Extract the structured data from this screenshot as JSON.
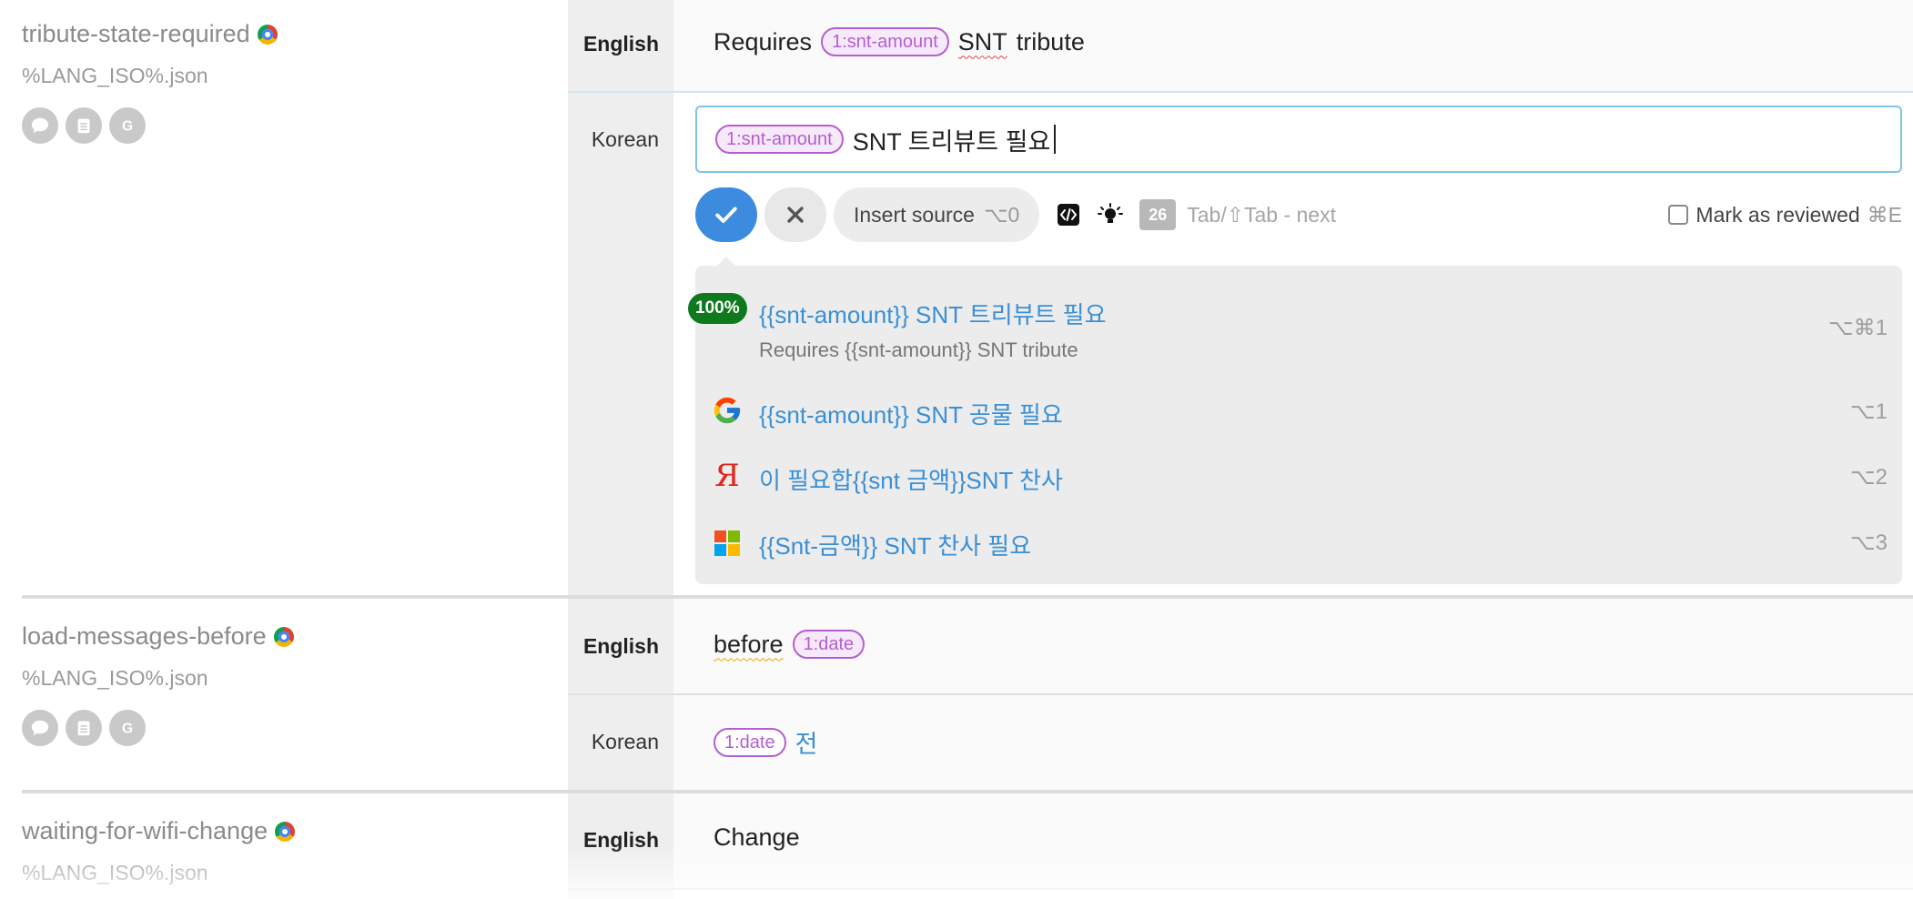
{
  "entries": [
    {
      "key": "tribute-state-required",
      "file": "%LANG_ISO%.json",
      "source_lang": "English",
      "source_text_before": "Requires",
      "source_placeholder": "1:snt-amount",
      "source_word_flagged": "SNT",
      "source_text_after": "tribute",
      "target_lang": "Korean",
      "target_placeholder": "1:snt-amount",
      "target_text": "SNT 트리뷰트 필요"
    },
    {
      "key": "load-messages-before",
      "file": "%LANG_ISO%.json",
      "source_lang": "English",
      "source_word_flagged": "before",
      "source_placeholder": "1:date",
      "target_lang": "Korean",
      "target_placeholder": "1:date",
      "target_text": "전"
    },
    {
      "key": "waiting-for-wifi-change",
      "file": "%LANG_ISO%.json",
      "source_lang": "English",
      "source_text": "Change"
    }
  ],
  "toolbar": {
    "insert_label": "Insert source",
    "insert_shortcut": "⌥0",
    "counter": "26",
    "hint": "Tab/⇧Tab - next",
    "reviewed_label": "Mark as reviewed",
    "reviewed_shortcut": "⌘E"
  },
  "suggestions": [
    {
      "provider": "translation-memory",
      "match": "100%",
      "text": "{{snt-amount}} SNT 트리뷰트 필요",
      "source": "Requires {{snt-amount}} SNT tribute",
      "shortcut": "⌥⌘1"
    },
    {
      "provider": "google",
      "text": "{{snt-amount}} SNT 공물 필요",
      "shortcut": "⌥1"
    },
    {
      "provider": "yandex",
      "icon_glyph": "Я",
      "text": "이 필요합{{snt 금액}}SNT 찬사",
      "shortcut": "⌥2"
    },
    {
      "provider": "microsoft",
      "text": "{{Snt-금액}} SNT 찬사 필요",
      "shortcut": "⌥3"
    }
  ],
  "colors": {
    "accent": "#3d8bdf",
    "placeholder": "#b55ed1",
    "suggestion_text": "#3a8fd6",
    "match_badge": "#0e7a1d"
  }
}
